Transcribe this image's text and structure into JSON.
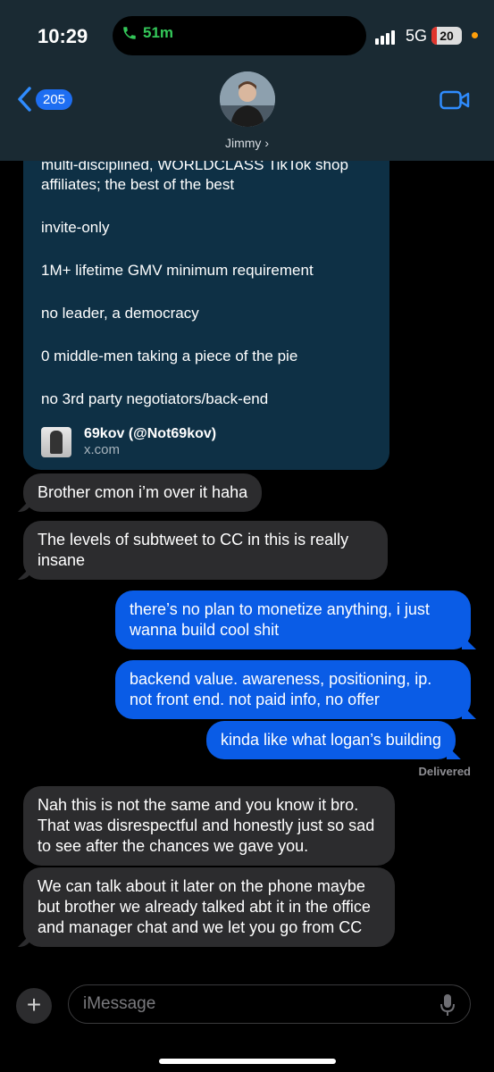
{
  "status_bar": {
    "time": "10:29",
    "call_duration": "51m",
    "network": "5G",
    "battery": "20"
  },
  "header": {
    "back_count": "205",
    "contact_name": "Jimmy ›"
  },
  "link_preview": {
    "lines": [
      "multi-disciplined, WORLDCLASS TikTok shop affiliates; the best of the best",
      "invite-only",
      "1M+ lifetime GMV minimum requirement",
      "no leader, a democracy",
      "0 middle-men taking a piece of the pie",
      "no 3rd party negotiators/back-end"
    ],
    "title": "69kov (@Not69kov)",
    "domain": "x.com"
  },
  "messages": [
    {
      "side": "received",
      "text": "Brother cmon i’m over it haha"
    },
    {
      "side": "received",
      "text": "The levels of subtweet to CC in this is really insane"
    },
    {
      "side": "sent",
      "text": "there’s no plan to monetize anything, i just wanna build cool shit"
    },
    {
      "side": "sent",
      "text": "backend value. awareness, positioning, ip. not front end. not paid info, no offer"
    },
    {
      "side": "sent",
      "text": "kinda like what logan’s building"
    },
    {
      "side": "received",
      "text": "Nah this is not the same and you know it bro. That was disrespectful and honestly just so sad to see after the chances we gave you."
    },
    {
      "side": "received",
      "text": "We can talk about it later on the phone maybe but brother we already talked abt it in the office and manager chat and we let you go from CC"
    }
  ],
  "delivered_label": "Delivered",
  "input": {
    "placeholder": "iMessage"
  },
  "colors": {
    "sent_bubble": "#0a5ce6",
    "received_bubble": "#2c2c2e",
    "header_bg": "#1a2a33",
    "link_card_bg": "#0e3045",
    "call_green": "#34c759"
  },
  "icons": [
    "phone-icon",
    "signal-icon",
    "battery-icon",
    "back-chevron-icon",
    "video-call-icon",
    "plus-icon",
    "microphone-icon"
  ]
}
